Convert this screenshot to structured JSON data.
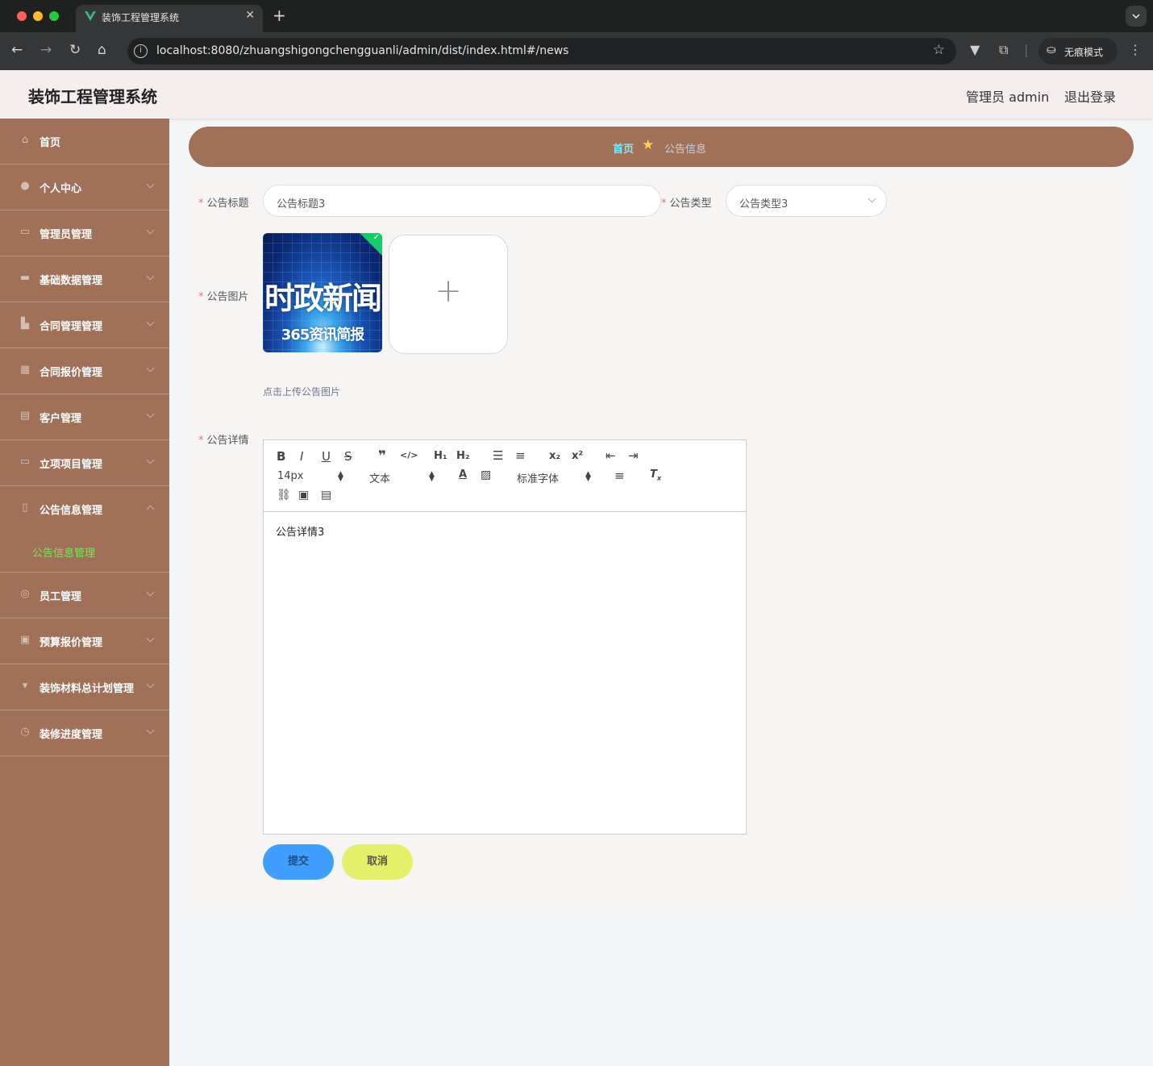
{
  "browser": {
    "tab_title": "装饰工程管理系统",
    "tab_close": "✕",
    "new_tab": "+",
    "url": "localhost:8080/zhuangshigongchengguanli/admin/dist/index.html#/news",
    "incognito_label": "无痕模式",
    "icons": [
      "back-icon",
      "forward-icon",
      "reload-icon",
      "home-icon",
      "site-info-icon",
      "bookmark-star-icon",
      "extension-icon",
      "puzzle-icon",
      "incognito-icon",
      "menu-dots-icon"
    ]
  },
  "header": {
    "title": "装饰工程管理系统",
    "user": "管理员 admin",
    "logout": "退出登录"
  },
  "sidebar": {
    "items": [
      {
        "label": "首页",
        "icon": "home-icon"
      },
      {
        "label": "个人中心",
        "icon": "user-icon"
      },
      {
        "label": "管理员管理",
        "icon": "message-icon"
      },
      {
        "label": "基础数据管理",
        "icon": "briefcase-icon"
      },
      {
        "label": "合同管理管理",
        "icon": "contract-icon"
      },
      {
        "label": "合同报价管理",
        "icon": "grid-icon"
      },
      {
        "label": "客户管理",
        "icon": "chat-icon"
      },
      {
        "label": "立项项目管理",
        "icon": "monitor-icon"
      },
      {
        "label": "公告信息管理",
        "icon": "mobile-icon",
        "open": true,
        "sub": "公告信息管理"
      },
      {
        "label": "员工管理",
        "icon": "help-icon"
      },
      {
        "label": "预算报价管理",
        "icon": "clipboard-icon"
      },
      {
        "label": "装饰材料总计划管理",
        "icon": "cup-icon"
      },
      {
        "label": "装修进度管理",
        "icon": "clock-icon"
      }
    ]
  },
  "breadcrumb": {
    "home": "首页",
    "current": "公告信息"
  },
  "form": {
    "title_label": "公告标题",
    "title_value": "公告标题3",
    "type_label": "公告类型",
    "type_value": "公告类型3",
    "image_label": "公告图片",
    "image_thumb_line1": "时政新闻",
    "image_thumb_line2": "365资讯简报",
    "upload_tip": "点击上传公告图片",
    "detail_label": "公告详情",
    "detail_value": "公告详情3",
    "submit": "提交",
    "cancel": "取消",
    "required_mark": "*"
  },
  "editor": {
    "font_size": "14px",
    "header_picker": "文本",
    "font_family": "标准字体",
    "h1": "H₁",
    "h2": "H₂",
    "sub": "x₂",
    "sup": "x²"
  },
  "colors": {
    "sidebar_bg": "#a07058",
    "breadcrumb_home": "#7fe8ff",
    "submenu_active": "#7fe35a",
    "submit_bg": "#409eff",
    "cancel_bg": "#e4f06a",
    "required": "#f56c6c"
  }
}
